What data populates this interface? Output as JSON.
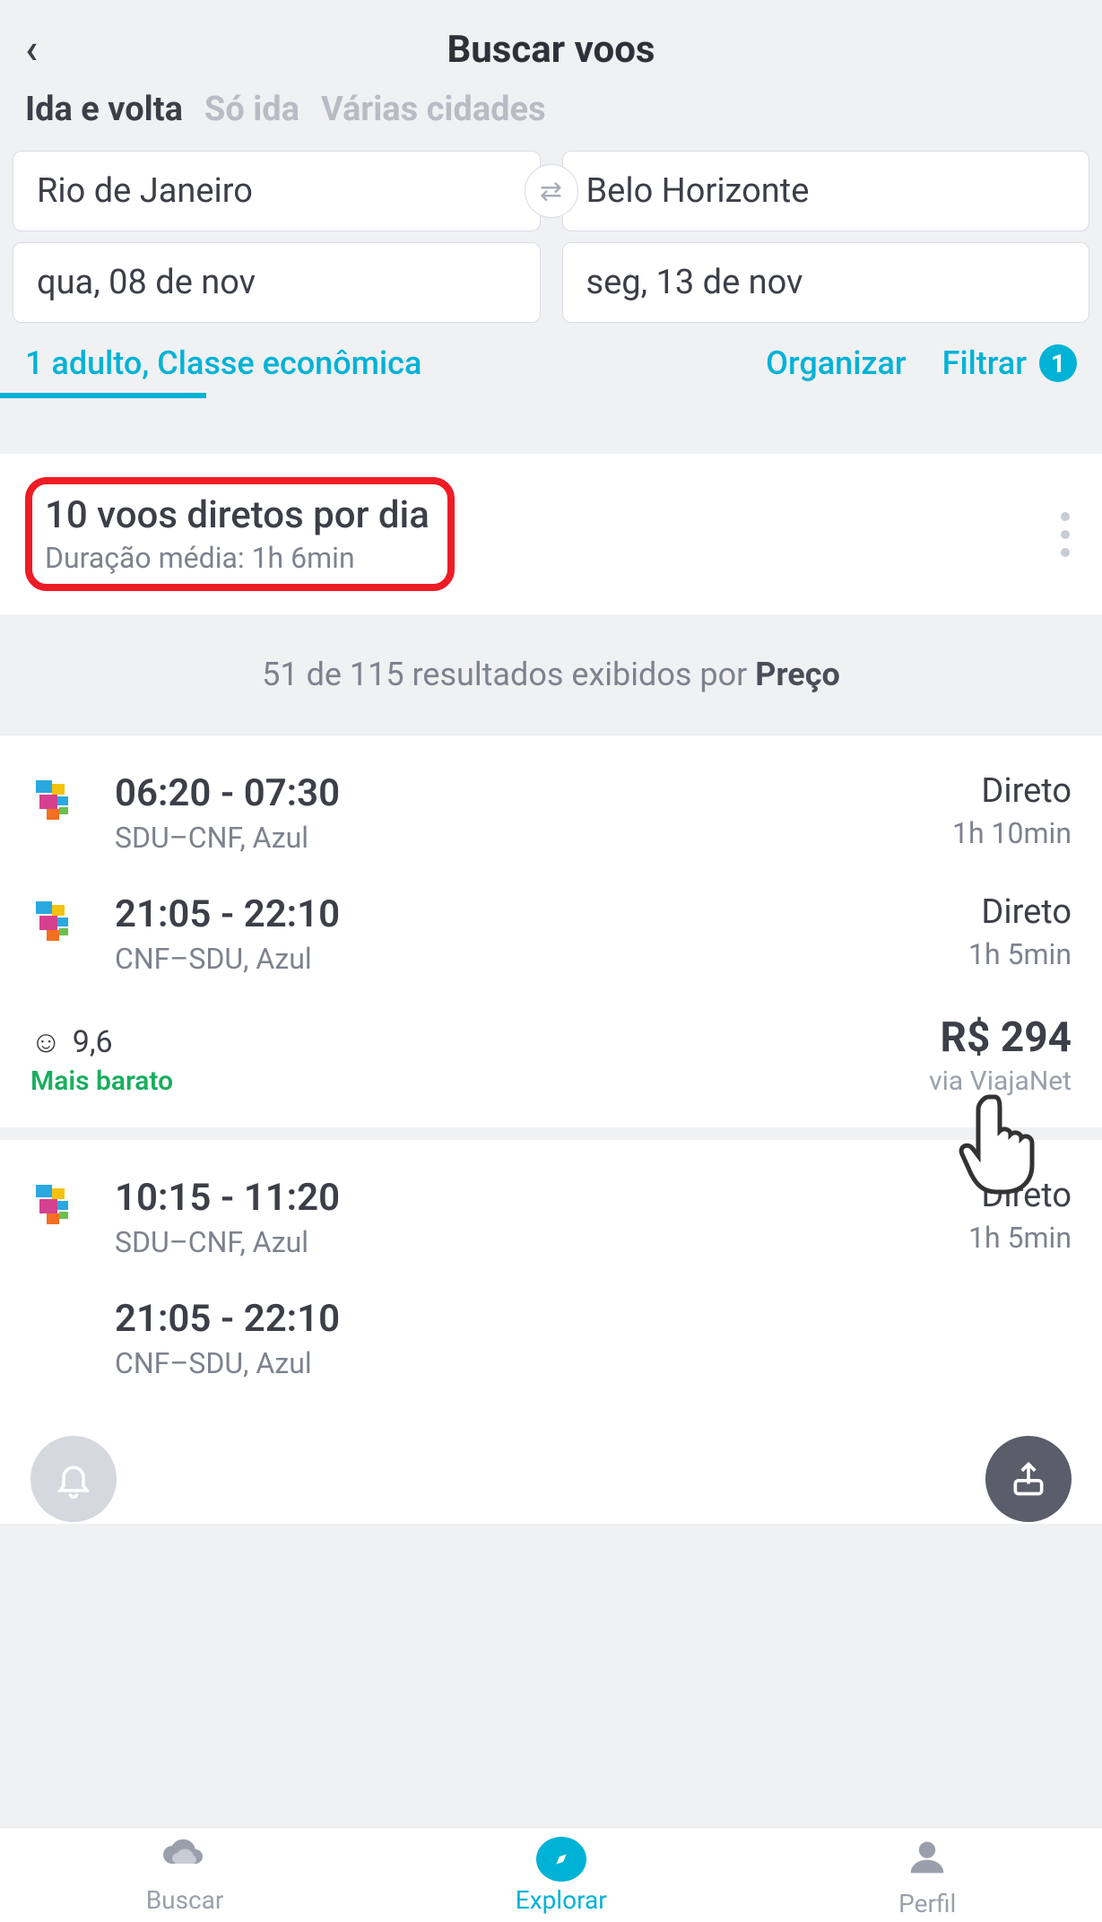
{
  "header": {
    "title": "Buscar voos"
  },
  "trip_tabs": {
    "roundtrip": "Ida e volta",
    "oneway": "Só ida",
    "multicity": "Várias cidades"
  },
  "search": {
    "origin": "Rio de Janeiro",
    "destination": "Belo Horizonte",
    "depart": "qua, 08 de nov",
    "ret": "seg, 13 de nov"
  },
  "toolbar": {
    "pax": "1 adulto, Classe econômica",
    "organize": "Organizar",
    "filter": "Filtrar",
    "filter_count": "1"
  },
  "summary": {
    "direct_flights": "10 voos diretos por dia",
    "avg_duration": "Duração média: 1h 6min"
  },
  "sort": {
    "text_prefix": "51 de 115 resultados exibidos por ",
    "key": "Preço"
  },
  "cards": [
    {
      "legs": [
        {
          "times": "06:20 - 07:30",
          "route": "SDU–CNF, Azul",
          "stops": "Direto",
          "duration": "1h 10min"
        },
        {
          "times": "21:05 - 22:10",
          "route": "CNF–SDU, Azul",
          "stops": "Direto",
          "duration": "1h 5min"
        }
      ],
      "rating": "9,6",
      "cheapest_label": "Mais barato",
      "price": "R$ 294",
      "via": "via ViajaNet"
    },
    {
      "legs": [
        {
          "times": "10:15 - 11:20",
          "route": "SDU–CNF, Azul",
          "stops": "Direto",
          "duration": "1h 5min"
        },
        {
          "times": "21:05 - 22:10",
          "route": "CNF–SDU, Azul",
          "stops": "",
          "duration": ""
        }
      ]
    }
  ],
  "nav": {
    "search": "Buscar",
    "explore": "Explorar",
    "profile": "Perfil"
  }
}
